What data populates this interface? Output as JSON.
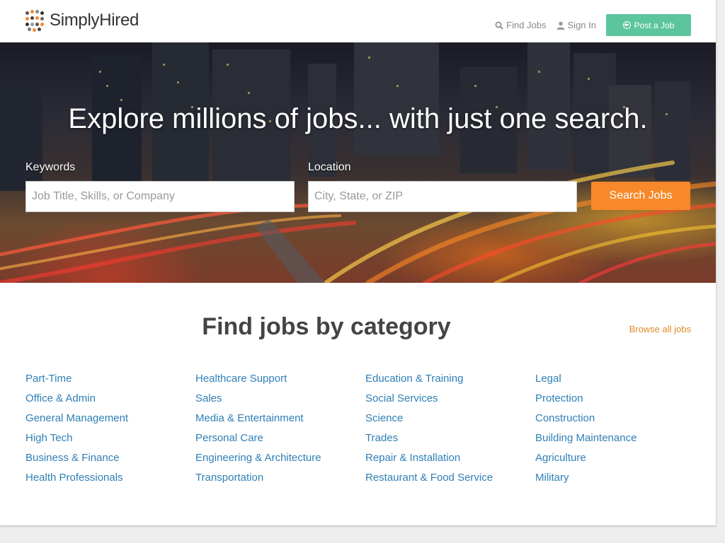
{
  "brand": {
    "name": "SimplyHired",
    "accent_green": "#5cc59e",
    "accent_orange": "#f7892a",
    "link_blue": "#2f7fb6"
  },
  "nav": {
    "find_jobs": "Find Jobs",
    "sign_in": "Sign In",
    "post_job": "Post a Job",
    "icons": [
      "search-icon",
      "user-icon",
      "plus-circle-icon"
    ]
  },
  "hero": {
    "title": "Explore millions of jobs... with just one search.",
    "keywords_label": "Keywords",
    "keywords_placeholder": "Job Title, Skills, or Company",
    "keywords_value": "",
    "location_label": "Location",
    "location_placeholder": "City, State, or ZIP",
    "location_value": "",
    "search_button": "Search Jobs"
  },
  "categories": {
    "title": "Find jobs by category",
    "browse_all": "Browse all jobs",
    "columns": [
      [
        "Part-Time",
        "Office & Admin",
        "General Management",
        "High Tech",
        "Business & Finance",
        "Health Professionals"
      ],
      [
        "Healthcare Support",
        "Sales",
        "Media & Entertainment",
        "Personal Care",
        "Engineering & Architecture",
        "Transportation"
      ],
      [
        "Education & Training",
        "Social Services",
        "Science",
        "Trades",
        "Repair & Installation",
        "Restaurant & Food Service"
      ],
      [
        "Legal",
        "Protection",
        "Construction",
        "Building Maintenance",
        "Agriculture",
        "Military"
      ]
    ]
  }
}
